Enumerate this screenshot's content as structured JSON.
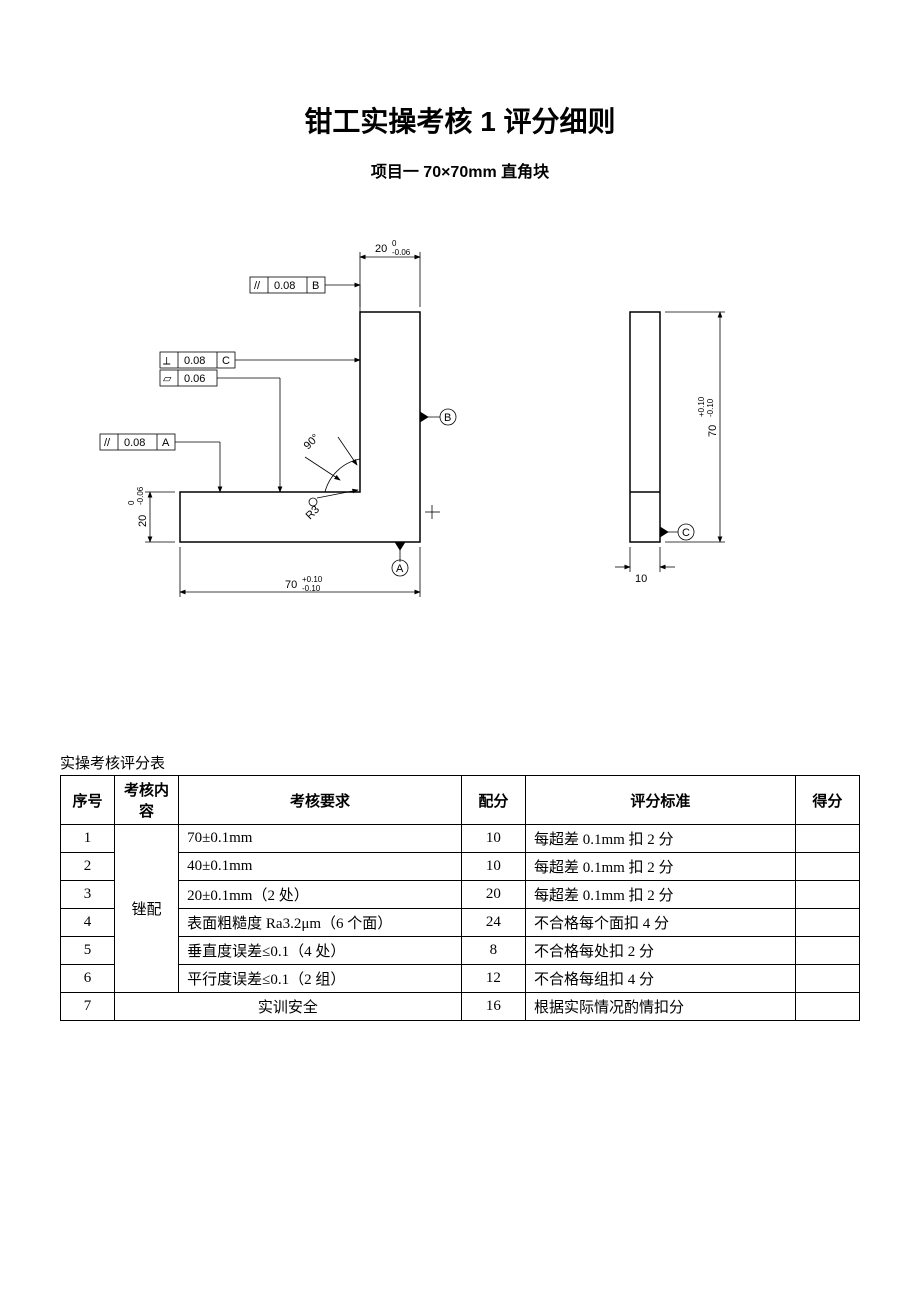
{
  "title": "钳工实操考核 1 评分细则",
  "subtitle": "项目一  70×70mm 直角块",
  "table_caption": "实操考核评分表",
  "headers": {
    "seq": "序号",
    "content": "考核内容",
    "req": "考核要求",
    "score": "配分",
    "std": "评分标准",
    "got": "得分"
  },
  "content_merged": "锉配",
  "rows": [
    {
      "seq": "1",
      "req": "70±0.1mm",
      "score": "10",
      "std": "每超差 0.1mm 扣 2 分"
    },
    {
      "seq": "2",
      "req": "40±0.1mm",
      "score": "10",
      "std": "每超差 0.1mm 扣 2 分"
    },
    {
      "seq": "3",
      "req": "20±0.1mm（2 处）",
      "score": "20",
      "std": "每超差 0.1mm 扣 2 分"
    },
    {
      "seq": "4",
      "req": "表面粗糙度 Ra3.2μm（6 个面）",
      "score": "24",
      "std": "不合格每个面扣 4 分"
    },
    {
      "seq": "5",
      "req": "垂直度误差≤0.1（4 处）",
      "score": "8",
      "std": "不合格每处扣 2 分"
    },
    {
      "seq": "6",
      "req": "平行度误差≤0.1（2 组）",
      "score": "12",
      "std": "不合格每组扣 4 分"
    },
    {
      "seq": "7",
      "req": "实训安全",
      "score": "16",
      "std": "根据实际情况酌情扣分"
    }
  ],
  "drawing": {
    "dim_20_top": "20",
    "dim_20_top_tol_u": "0",
    "dim_20_top_tol_l": "-0.06",
    "dim_20_left": "20",
    "dim_20_left_tol_u": "0",
    "dim_20_left_tol_l": "-0.06",
    "dim_70_bottom": "70",
    "dim_70_bottom_tol_u": "+0.10",
    "dim_70_bottom_tol_l": "-0.10",
    "dim_70_right": "70",
    "dim_70_right_tol_u": "+0.10",
    "dim_70_right_tol_l": "-0.10",
    "dim_10": "10",
    "gdt_par_b": "0.08",
    "gdt_par_b_ref": "B",
    "gdt_perp_c": "0.08",
    "gdt_perp_c_ref": "C",
    "gdt_flat": "0.06",
    "gdt_par_a": "0.08",
    "gdt_par_a_ref": "A",
    "datum_a": "A",
    "datum_b": "B",
    "datum_c": "C",
    "angle_90": "90°",
    "radius": "R3"
  }
}
